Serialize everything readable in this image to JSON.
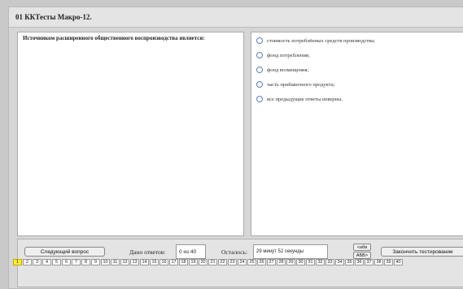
{
  "window": {
    "title": "01 ККТесты Макро-12."
  },
  "question": {
    "text": "Источником расширенного общественного воспроизводства является:"
  },
  "answers": [
    "стоимость потреблённых средств производства;",
    "фонд потребления;",
    "фонд возмещения;",
    "часть прибавочного продукта;",
    "все предыдущие ответы неверны."
  ],
  "controls": {
    "next_button": "Следующий вопрос",
    "answered_label": "Дано ответов:",
    "answered_value": "0 из 40",
    "remaining_label": "Осталось:",
    "remaining_value": "29 минут 52 секунды",
    "layout_toggle_top": "<абв",
    "layout_toggle_bottom": "АБВ>",
    "finish_button": "Закончить тестирование"
  },
  "navigation": {
    "active_question": "1",
    "questions": [
      "1",
      "2",
      "3",
      "4",
      "5",
      "6",
      "7",
      "8",
      "9",
      "10",
      "11",
      "12",
      "13",
      "14",
      "15",
      "16",
      "17",
      "18",
      "19",
      "20",
      "21",
      "22",
      "23",
      "24",
      "25",
      "26",
      "27",
      "28",
      "29",
      "30",
      "31",
      "32",
      "33",
      "34",
      "35",
      "36",
      "37",
      "38",
      "39",
      "40"
    ]
  }
}
